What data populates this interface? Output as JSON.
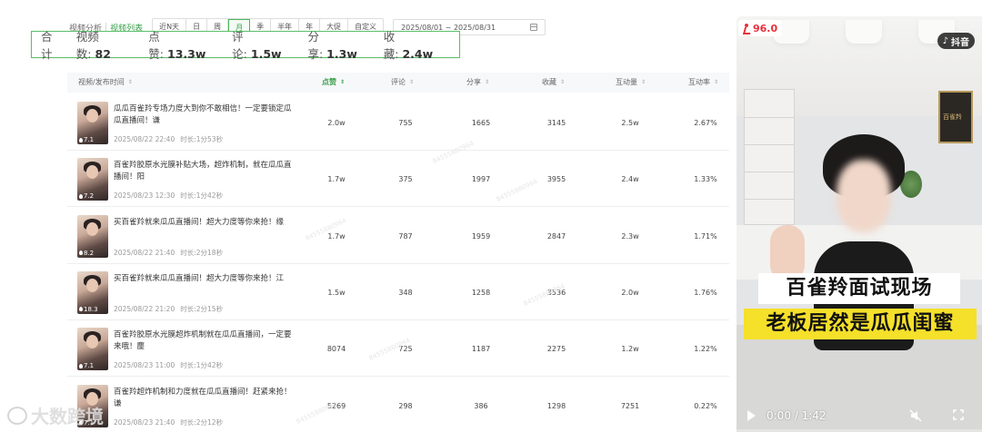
{
  "filter": {
    "tab_analysis": "视频分析",
    "tab_list": "视频列表",
    "sep": "|",
    "ranges": [
      "近N天",
      "日",
      "周",
      "月",
      "季",
      "半年",
      "年",
      "大促",
      "自定义"
    ],
    "active_range": "月",
    "date_range": "2025/08/01 ~ 2025/08/31"
  },
  "summary": {
    "label_total": "合计",
    "video_count_label": "视频数:",
    "video_count": "82",
    "likes_label": "点赞:",
    "likes": "13.3w",
    "comments_label": "评论:",
    "comments": "1.5w",
    "shares_label": "分享:",
    "shares": "1.3w",
    "favorites_label": "收藏:",
    "favorites": "2.4w"
  },
  "table": {
    "headers": {
      "video": "视频/发布时间",
      "likes": "点赞",
      "comments": "评论",
      "shares": "分享",
      "favorites": "收藏",
      "interactions": "互动量",
      "rate": "互动率"
    },
    "duration_label": "时长:",
    "rows": [
      {
        "title": "瓜瓜百雀羚专场力度大到你不敢相信！一定要锁定瓜瓜直播间！谦",
        "date": "2025/08/22 22:40",
        "duration": "1分53秒",
        "badge": "7.1",
        "likes": "2.0w",
        "comments": "755",
        "shares": "1665",
        "favorites": "3145",
        "interactions": "2.5w",
        "rate": "2.67%"
      },
      {
        "title": "百雀羚胶原水光膜补贴大场，超炸机制，就在瓜瓜直播间！阳",
        "date": "2025/08/23 12:30",
        "duration": "1分42秒",
        "badge": "7.2",
        "likes": "1.7w",
        "comments": "375",
        "shares": "1997",
        "favorites": "3955",
        "interactions": "2.4w",
        "rate": "1.33%"
      },
      {
        "title": "买百雀羚就来瓜瓜直播间！超大力度等你来抢！缘",
        "date": "2025/08/22 21:40",
        "duration": "2分18秒",
        "badge": "8.2",
        "likes": "1.7w",
        "comments": "787",
        "shares": "1959",
        "favorites": "2847",
        "interactions": "2.3w",
        "rate": "1.71%"
      },
      {
        "title": "买百雀羚就来瓜瓜直播间！超大力度等你来抢！江",
        "date": "2025/08/22 21:20",
        "duration": "2分15秒",
        "badge": "18.3",
        "likes": "1.5w",
        "comments": "348",
        "shares": "1258",
        "favorites": "3536",
        "interactions": "2.0w",
        "rate": "1.76%"
      },
      {
        "title": "百雀羚胶原水光膜超炸机制就在瓜瓜直播间，一定要来哦！麈",
        "date": "2025/08/23 11:00",
        "duration": "1分42秒",
        "badge": "7.1",
        "likes": "8074",
        "comments": "725",
        "shares": "1187",
        "favorites": "2275",
        "interactions": "1.2w",
        "rate": "1.22%"
      },
      {
        "title": "百雀羚超炸机制和力度就在瓜瓜直播间！赶紧来抢！谦",
        "date": "2025/08/23 21:40",
        "duration": "2分12秒",
        "badge": "7.1",
        "likes": "5269",
        "comments": "298",
        "shares": "386",
        "favorites": "1298",
        "interactions": "7251",
        "rate": "0.22%"
      }
    ]
  },
  "watermark": "84555880964",
  "video": {
    "score": "96.0",
    "platform": "抖音",
    "store_logo": "百雀羚",
    "caption_line1": "百雀羚面试现场",
    "caption_line2": "老板居然是瓜瓜闺蜜",
    "time": "0:00 / 1:42",
    "progress": 0
  },
  "brand": "大数跨境"
}
